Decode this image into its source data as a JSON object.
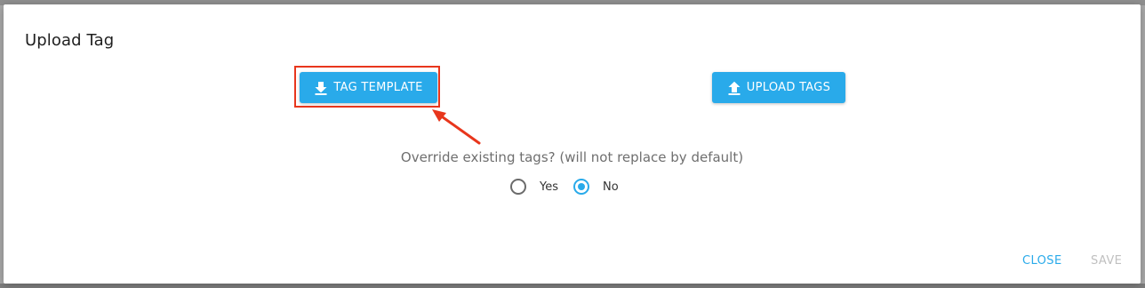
{
  "dialog": {
    "title": "Upload Tag"
  },
  "buttons": {
    "tag_template": {
      "label": "TAG TEMPLATE",
      "icon": "download-icon"
    },
    "upload_tags": {
      "label": "UPLOAD TAGS",
      "icon": "upload-icon"
    }
  },
  "override": {
    "question": "Override existing tags? (will not replace by default)",
    "options": [
      {
        "label": "Yes",
        "checked": false
      },
      {
        "label": "No",
        "checked": true
      }
    ]
  },
  "actions": {
    "close_label": "CLOSE",
    "save_label": "SAVE",
    "save_disabled": true
  },
  "annotation": {
    "highlight_color": "#e8361c"
  },
  "colors": {
    "accent": "#29aaea",
    "disabled": "#c0c0c0"
  }
}
